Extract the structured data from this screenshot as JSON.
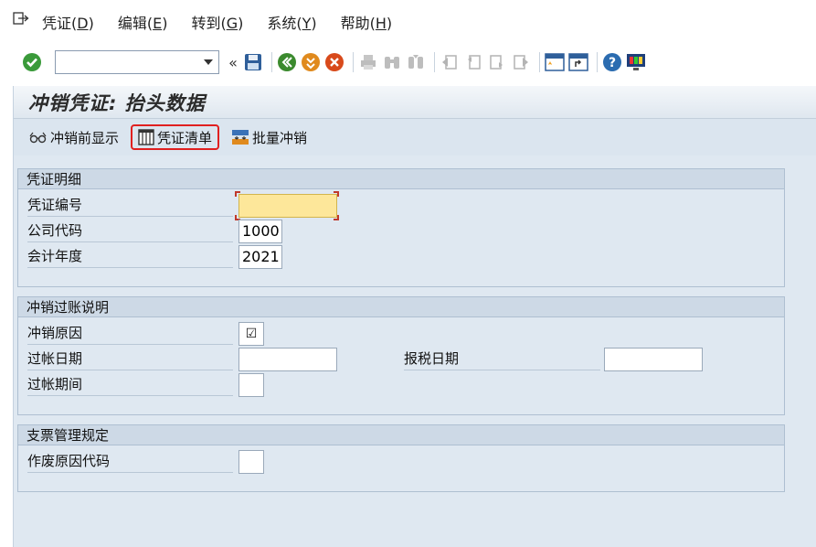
{
  "menubar": {
    "icon": "exit-menu-icon",
    "items": [
      {
        "label": "凭证(D)",
        "text": "凭证(",
        "key": "D",
        "close": ")"
      },
      {
        "label": "编辑(E)",
        "text": "编辑(",
        "key": "E",
        "close": ")"
      },
      {
        "label": "转到(G)",
        "text": "转到(",
        "key": "G",
        "close": ")"
      },
      {
        "label": "系统(Y)",
        "text": "系统(",
        "key": "Y",
        "close": ")"
      },
      {
        "label": "帮助(H)",
        "text": "帮助(",
        "key": "H",
        "close": ")"
      }
    ]
  },
  "toolbar": {
    "command_value": "",
    "icons": [
      "enter-check-icon",
      "save-icon",
      "back-icon",
      "exit-icon",
      "cancel-icon",
      "print-icon",
      "find-icon",
      "find-next-icon",
      "first-page-icon",
      "previous-page-icon",
      "next-page-icon",
      "last-page-icon",
      "create-session-icon",
      "shortcut-icon",
      "help-icon",
      "customize-layout-icon"
    ],
    "colors": {
      "check": "#3a9a3a",
      "back": "#3b8a2e",
      "exit": "#e08a1e",
      "cancel": "#d84a1b",
      "help": "#2b6cb0"
    }
  },
  "screen": {
    "title": "冲销凭证: 抬头数据"
  },
  "app_toolbar": {
    "display_before_reversal": "冲销前显示",
    "document_list": "凭证清单",
    "mass_reversal": "批量冲销"
  },
  "doc_details": {
    "title": "凭证明细",
    "doc_number_label": "凭证编号",
    "doc_number_value": "",
    "company_code_label": "公司代码",
    "company_code_value": "1000",
    "fiscal_year_label": "会计年度",
    "fiscal_year_value": "2021"
  },
  "reversal_details": {
    "title": "冲销过账说明",
    "reason_label": "冲销原因",
    "reason_value": "☑",
    "posting_date_label": "过帐日期",
    "posting_date_value": "",
    "tax_date_label": "报税日期",
    "tax_date_value": "",
    "posting_period_label": "过帐期间",
    "posting_period_value": ""
  },
  "check_mgmt": {
    "title": "支票管理规定",
    "void_reason_label": "作废原因代码",
    "void_reason_value": ""
  },
  "colors": {
    "background": "#dfe8f1",
    "required_field": "#fde79a",
    "highlight_box": "#e02020"
  }
}
